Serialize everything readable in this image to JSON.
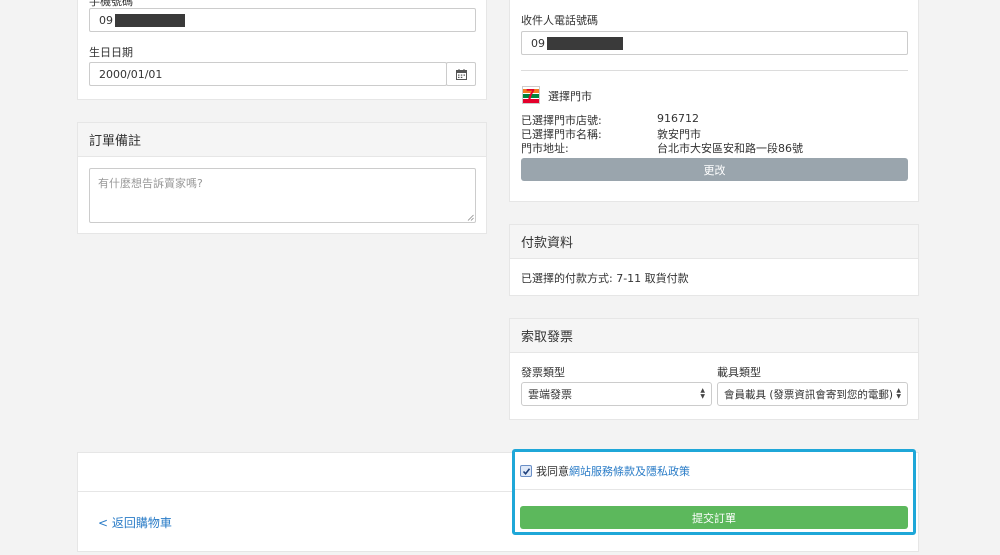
{
  "left": {
    "phone_label_partial": "手機號碼",
    "phone_value": "09",
    "birthday_label": "生日日期",
    "birthday_value": "2000/01/01",
    "note_title": "訂單備註",
    "note_placeholder": "有什麼想告訴賣家嗎?"
  },
  "right": {
    "recipient_phone_label": "收件人電話號碼",
    "recipient_phone_value": "09",
    "store_select_label": "選擇門市",
    "store_id_label": "已選擇門市店號:",
    "store_id_value": "916712",
    "store_name_label": "已選擇門市名稱:",
    "store_name_value": "敦安門市",
    "store_address_label": "門市地址:",
    "store_address_value": "台北市大安區安和路一段86號",
    "change_button": "更改",
    "store_logo_text": "7"
  },
  "payment": {
    "title": "付款資料",
    "method": "已選擇的付款方式: 7-11 取貨付款"
  },
  "invoice": {
    "title": "索取發票",
    "type_label": "發票類型",
    "type_value": "雲端發票",
    "carrier_label": "載具類型",
    "carrier_value": "會員載具 (發票資訊會寄到您的電郵)"
  },
  "footer": {
    "back_link": "< 返回購物車",
    "agree_prefix": "我同意",
    "agree_link": "網站服務條款及隱私政策",
    "submit_button": "提交訂單"
  },
  "colors": {
    "accent_link": "#2a7cc7",
    "submit_green": "#5cb85c",
    "change_gray": "#9aa5ad",
    "highlight_border": "#1fa7d8"
  }
}
